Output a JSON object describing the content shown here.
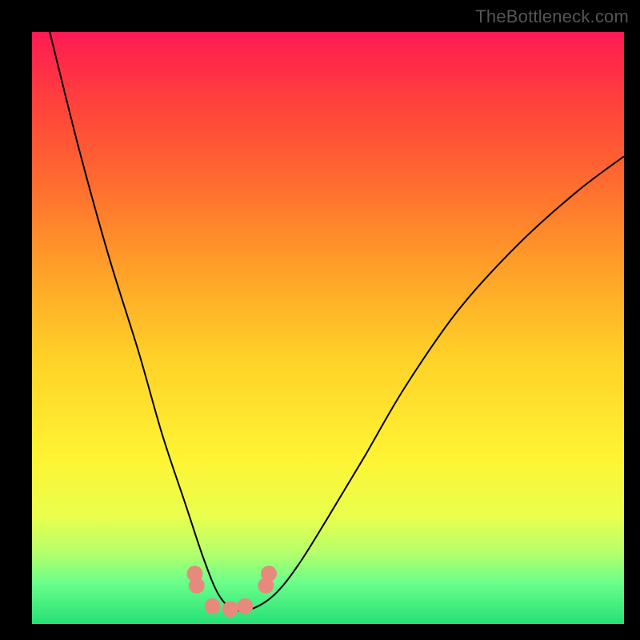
{
  "watermark": "TheBottleneck.com",
  "chart_data": {
    "type": "line",
    "title": "",
    "xlabel": "",
    "ylabel": "",
    "xlim": [
      0,
      1
    ],
    "ylim": [
      0,
      1
    ],
    "background": "rainbow-gradient-vertical",
    "series": [
      {
        "name": "bottleneck-curve",
        "color": "#000000",
        "stroke_width": 2,
        "x": [
          0.03,
          0.08,
          0.13,
          0.18,
          0.22,
          0.26,
          0.29,
          0.315,
          0.34,
          0.37,
          0.41,
          0.45,
          0.5,
          0.56,
          0.63,
          0.72,
          0.82,
          0.92,
          1.0
        ],
        "y": [
          1.0,
          0.8,
          0.62,
          0.46,
          0.32,
          0.2,
          0.11,
          0.05,
          0.025,
          0.025,
          0.05,
          0.1,
          0.18,
          0.28,
          0.4,
          0.53,
          0.64,
          0.73,
          0.79
        ]
      },
      {
        "name": "markers",
        "type": "scatter",
        "color": "#e78a7d",
        "radius": 10,
        "x": [
          0.275,
          0.278,
          0.305,
          0.335,
          0.36,
          0.395,
          0.4
        ],
        "y": [
          0.085,
          0.065,
          0.03,
          0.025,
          0.03,
          0.065,
          0.085
        ]
      }
    ]
  }
}
